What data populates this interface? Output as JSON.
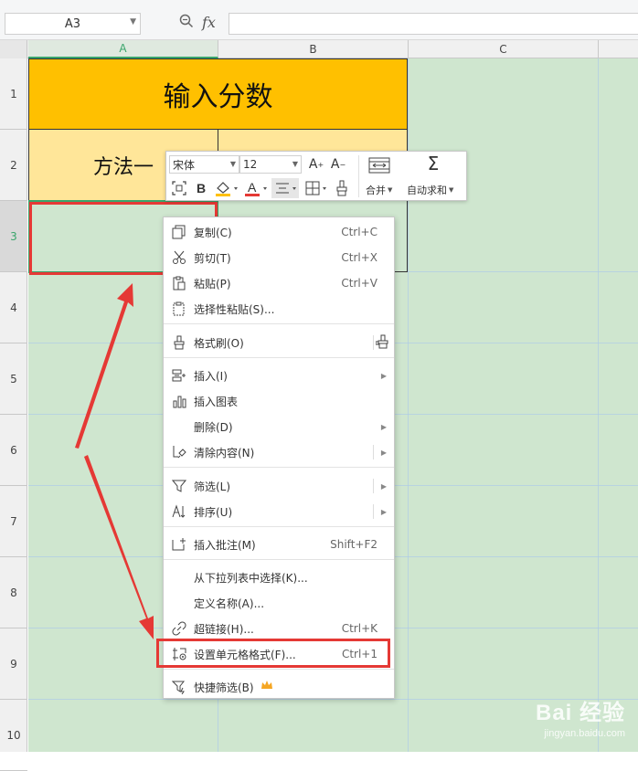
{
  "formula_bar": {
    "namebox_value": "A3",
    "fx_label": "fx"
  },
  "columns": [
    "A",
    "B",
    "C"
  ],
  "rows": [
    "1",
    "2",
    "3",
    "4",
    "5",
    "6",
    "7",
    "8",
    "9",
    "10"
  ],
  "cells": {
    "a1": "输入分数",
    "a2": "方法一"
  },
  "mini_toolbar": {
    "font_name": "宋体",
    "font_size": "12",
    "bold": "B",
    "merge_label": "合并",
    "autosum_label": "自动求和"
  },
  "context_menu": {
    "items": [
      {
        "label": "复制(C)",
        "shortcut": "Ctrl+C",
        "icon": "copy-icon"
      },
      {
        "label": "剪切(T)",
        "shortcut": "Ctrl+X",
        "icon": "scissors-icon"
      },
      {
        "label": "粘贴(P)",
        "shortcut": "Ctrl+V",
        "icon": "paste-icon"
      },
      {
        "label": "选择性粘贴(S)...",
        "shortcut": "",
        "icon": "paste-special-icon"
      },
      {
        "label": "格式刷(O)",
        "shortcut": "",
        "icon": "format-brush-icon"
      },
      {
        "label": "插入(I)",
        "shortcut": "",
        "icon": "insert-icon"
      },
      {
        "label": "插入图表",
        "shortcut": "",
        "icon": "chart-icon"
      },
      {
        "label": "删除(D)",
        "shortcut": "",
        "icon": ""
      },
      {
        "label": "清除内容(N)",
        "shortcut": "",
        "icon": "eraser-icon"
      },
      {
        "label": "筛选(L)",
        "shortcut": "",
        "icon": "filter-icon"
      },
      {
        "label": "排序(U)",
        "shortcut": "",
        "icon": "sort-icon"
      },
      {
        "label": "插入批注(M)",
        "shortcut": "Shift+F2",
        "icon": "comment-icon"
      },
      {
        "label": "从下拉列表中选择(K)...",
        "shortcut": "",
        "icon": ""
      },
      {
        "label": "定义名称(A)...",
        "shortcut": "",
        "icon": ""
      },
      {
        "label": "超链接(H)...",
        "shortcut": "Ctrl+K",
        "icon": "link-icon"
      },
      {
        "label": "设置单元格格式(F)...",
        "shortcut": "Ctrl+1",
        "icon": "format-cells-icon"
      },
      {
        "label": "快捷筛选(B)",
        "shortcut": "",
        "icon": "quick-filter-icon"
      }
    ]
  },
  "watermark": {
    "brand": "Bai 经验",
    "url": "jingyan.baidu.com"
  },
  "colors": {
    "header_fill": "#ffc000",
    "row2_fill": "#ffe699",
    "sheet_bg": "#cfe6cf",
    "highlight_red": "#e53935",
    "active_green": "#3aa56b"
  }
}
